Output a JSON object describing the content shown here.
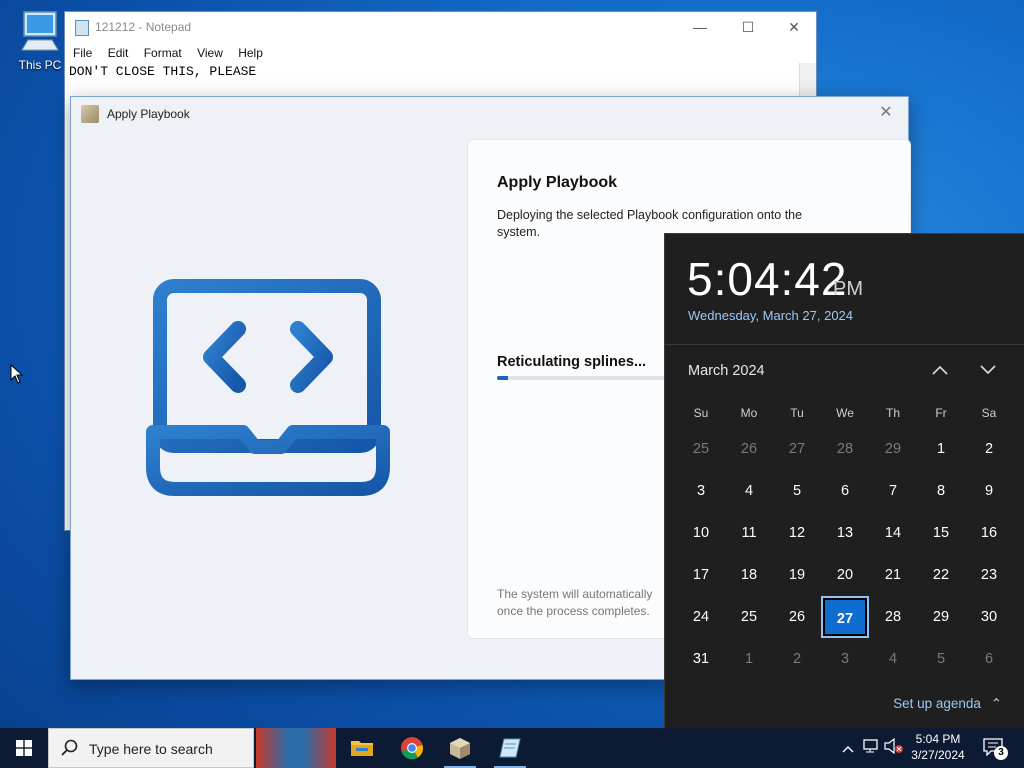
{
  "desktop": {
    "icon_label": "This PC"
  },
  "notepad": {
    "title": "121212 - Notepad",
    "menu": [
      "File",
      "Edit",
      "Format",
      "View",
      "Help"
    ],
    "text": "DON'T CLOSE THIS, PLEASE"
  },
  "dialog": {
    "title": "Apply Playbook",
    "heading": "Apply Playbook",
    "description": "Deploying the selected Playbook configuration onto the system.",
    "step": "Reticulating splines...",
    "progress_percent": 3,
    "footer": "The system will automatically\nonce the process completes."
  },
  "flyout": {
    "time": "5:04:42",
    "ampm": "PM",
    "date": "Wednesday, March 27, 2024",
    "month": "March 2024",
    "weekdays": [
      "Su",
      "Mo",
      "Tu",
      "We",
      "Th",
      "Fr",
      "Sa"
    ],
    "days": [
      {
        "d": "25",
        "dim": true
      },
      {
        "d": "26",
        "dim": true
      },
      {
        "d": "27",
        "dim": true
      },
      {
        "d": "28",
        "dim": true
      },
      {
        "d": "29",
        "dim": true
      },
      {
        "d": "1"
      },
      {
        "d": "2"
      },
      {
        "d": "3"
      },
      {
        "d": "4"
      },
      {
        "d": "5"
      },
      {
        "d": "6"
      },
      {
        "d": "7"
      },
      {
        "d": "8"
      },
      {
        "d": "9"
      },
      {
        "d": "10"
      },
      {
        "d": "11"
      },
      {
        "d": "12"
      },
      {
        "d": "13"
      },
      {
        "d": "14"
      },
      {
        "d": "15"
      },
      {
        "d": "16"
      },
      {
        "d": "17"
      },
      {
        "d": "18"
      },
      {
        "d": "19"
      },
      {
        "d": "20"
      },
      {
        "d": "21"
      },
      {
        "d": "22"
      },
      {
        "d": "23"
      },
      {
        "d": "24"
      },
      {
        "d": "25"
      },
      {
        "d": "26"
      },
      {
        "d": "27",
        "selected": true
      },
      {
        "d": "28"
      },
      {
        "d": "29"
      },
      {
        "d": "30"
      },
      {
        "d": "31"
      },
      {
        "d": "1",
        "dim": true
      },
      {
        "d": "2",
        "dim": true
      },
      {
        "d": "3",
        "dim": true
      },
      {
        "d": "4",
        "dim": true
      },
      {
        "d": "5",
        "dim": true
      },
      {
        "d": "6",
        "dim": true
      }
    ],
    "agenda_label": "Set up agenda"
  },
  "taskbar": {
    "search_placeholder": "Type here to search",
    "tray_time": "5:04 PM",
    "tray_date": "3/27/2024",
    "notification_count": "3"
  },
  "colors": {
    "accent": "#0f6cd1",
    "taskbar": "#0c1a33",
    "flyout_bg": "#1f1f1f",
    "link": "#9cc8f4"
  },
  "icons": [
    "this-pc-icon",
    "notepad-icon",
    "playbook-icon",
    "laptop-code-icon",
    "chevron-up-icon",
    "chevron-down-icon",
    "windows-start-icon",
    "search-icon",
    "file-explorer-icon",
    "chrome-icon",
    "network-icon",
    "volume-muted-icon",
    "notification-icon"
  ]
}
